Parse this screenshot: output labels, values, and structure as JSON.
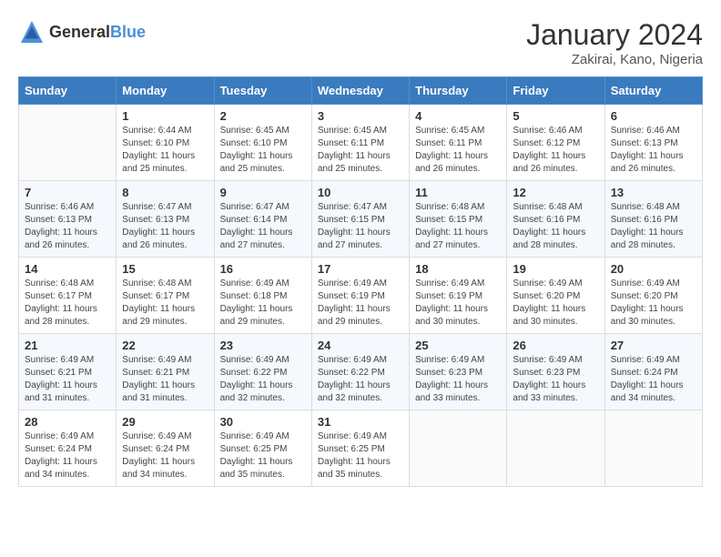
{
  "header": {
    "logo_general": "General",
    "logo_blue": "Blue",
    "month": "January 2024",
    "location": "Zakirai, Kano, Nigeria"
  },
  "weekdays": [
    "Sunday",
    "Monday",
    "Tuesday",
    "Wednesday",
    "Thursday",
    "Friday",
    "Saturday"
  ],
  "weeks": [
    [
      {
        "day": "",
        "sunrise": "",
        "sunset": "",
        "daylight": ""
      },
      {
        "day": "1",
        "sunrise": "Sunrise: 6:44 AM",
        "sunset": "Sunset: 6:10 PM",
        "daylight": "Daylight: 11 hours and 25 minutes."
      },
      {
        "day": "2",
        "sunrise": "Sunrise: 6:45 AM",
        "sunset": "Sunset: 6:10 PM",
        "daylight": "Daylight: 11 hours and 25 minutes."
      },
      {
        "day": "3",
        "sunrise": "Sunrise: 6:45 AM",
        "sunset": "Sunset: 6:11 PM",
        "daylight": "Daylight: 11 hours and 25 minutes."
      },
      {
        "day": "4",
        "sunrise": "Sunrise: 6:45 AM",
        "sunset": "Sunset: 6:11 PM",
        "daylight": "Daylight: 11 hours and 26 minutes."
      },
      {
        "day": "5",
        "sunrise": "Sunrise: 6:46 AM",
        "sunset": "Sunset: 6:12 PM",
        "daylight": "Daylight: 11 hours and 26 minutes."
      },
      {
        "day": "6",
        "sunrise": "Sunrise: 6:46 AM",
        "sunset": "Sunset: 6:13 PM",
        "daylight": "Daylight: 11 hours and 26 minutes."
      }
    ],
    [
      {
        "day": "7",
        "sunrise": "Sunrise: 6:46 AM",
        "sunset": "Sunset: 6:13 PM",
        "daylight": "Daylight: 11 hours and 26 minutes."
      },
      {
        "day": "8",
        "sunrise": "Sunrise: 6:47 AM",
        "sunset": "Sunset: 6:13 PM",
        "daylight": "Daylight: 11 hours and 26 minutes."
      },
      {
        "day": "9",
        "sunrise": "Sunrise: 6:47 AM",
        "sunset": "Sunset: 6:14 PM",
        "daylight": "Daylight: 11 hours and 27 minutes."
      },
      {
        "day": "10",
        "sunrise": "Sunrise: 6:47 AM",
        "sunset": "Sunset: 6:15 PM",
        "daylight": "Daylight: 11 hours and 27 minutes."
      },
      {
        "day": "11",
        "sunrise": "Sunrise: 6:48 AM",
        "sunset": "Sunset: 6:15 PM",
        "daylight": "Daylight: 11 hours and 27 minutes."
      },
      {
        "day": "12",
        "sunrise": "Sunrise: 6:48 AM",
        "sunset": "Sunset: 6:16 PM",
        "daylight": "Daylight: 11 hours and 28 minutes."
      },
      {
        "day": "13",
        "sunrise": "Sunrise: 6:48 AM",
        "sunset": "Sunset: 6:16 PM",
        "daylight": "Daylight: 11 hours and 28 minutes."
      }
    ],
    [
      {
        "day": "14",
        "sunrise": "Sunrise: 6:48 AM",
        "sunset": "Sunset: 6:17 PM",
        "daylight": "Daylight: 11 hours and 28 minutes."
      },
      {
        "day": "15",
        "sunrise": "Sunrise: 6:48 AM",
        "sunset": "Sunset: 6:17 PM",
        "daylight": "Daylight: 11 hours and 29 minutes."
      },
      {
        "day": "16",
        "sunrise": "Sunrise: 6:49 AM",
        "sunset": "Sunset: 6:18 PM",
        "daylight": "Daylight: 11 hours and 29 minutes."
      },
      {
        "day": "17",
        "sunrise": "Sunrise: 6:49 AM",
        "sunset": "Sunset: 6:19 PM",
        "daylight": "Daylight: 11 hours and 29 minutes."
      },
      {
        "day": "18",
        "sunrise": "Sunrise: 6:49 AM",
        "sunset": "Sunset: 6:19 PM",
        "daylight": "Daylight: 11 hours and 30 minutes."
      },
      {
        "day": "19",
        "sunrise": "Sunrise: 6:49 AM",
        "sunset": "Sunset: 6:20 PM",
        "daylight": "Daylight: 11 hours and 30 minutes."
      },
      {
        "day": "20",
        "sunrise": "Sunrise: 6:49 AM",
        "sunset": "Sunset: 6:20 PM",
        "daylight": "Daylight: 11 hours and 30 minutes."
      }
    ],
    [
      {
        "day": "21",
        "sunrise": "Sunrise: 6:49 AM",
        "sunset": "Sunset: 6:21 PM",
        "daylight": "Daylight: 11 hours and 31 minutes."
      },
      {
        "day": "22",
        "sunrise": "Sunrise: 6:49 AM",
        "sunset": "Sunset: 6:21 PM",
        "daylight": "Daylight: 11 hours and 31 minutes."
      },
      {
        "day": "23",
        "sunrise": "Sunrise: 6:49 AM",
        "sunset": "Sunset: 6:22 PM",
        "daylight": "Daylight: 11 hours and 32 minutes."
      },
      {
        "day": "24",
        "sunrise": "Sunrise: 6:49 AM",
        "sunset": "Sunset: 6:22 PM",
        "daylight": "Daylight: 11 hours and 32 minutes."
      },
      {
        "day": "25",
        "sunrise": "Sunrise: 6:49 AM",
        "sunset": "Sunset: 6:23 PM",
        "daylight": "Daylight: 11 hours and 33 minutes."
      },
      {
        "day": "26",
        "sunrise": "Sunrise: 6:49 AM",
        "sunset": "Sunset: 6:23 PM",
        "daylight": "Daylight: 11 hours and 33 minutes."
      },
      {
        "day": "27",
        "sunrise": "Sunrise: 6:49 AM",
        "sunset": "Sunset: 6:24 PM",
        "daylight": "Daylight: 11 hours and 34 minutes."
      }
    ],
    [
      {
        "day": "28",
        "sunrise": "Sunrise: 6:49 AM",
        "sunset": "Sunset: 6:24 PM",
        "daylight": "Daylight: 11 hours and 34 minutes."
      },
      {
        "day": "29",
        "sunrise": "Sunrise: 6:49 AM",
        "sunset": "Sunset: 6:24 PM",
        "daylight": "Daylight: 11 hours and 34 minutes."
      },
      {
        "day": "30",
        "sunrise": "Sunrise: 6:49 AM",
        "sunset": "Sunset: 6:25 PM",
        "daylight": "Daylight: 11 hours and 35 minutes."
      },
      {
        "day": "31",
        "sunrise": "Sunrise: 6:49 AM",
        "sunset": "Sunset: 6:25 PM",
        "daylight": "Daylight: 11 hours and 35 minutes."
      },
      {
        "day": "",
        "sunrise": "",
        "sunset": "",
        "daylight": ""
      },
      {
        "day": "",
        "sunrise": "",
        "sunset": "",
        "daylight": ""
      },
      {
        "day": "",
        "sunrise": "",
        "sunset": "",
        "daylight": ""
      }
    ]
  ]
}
